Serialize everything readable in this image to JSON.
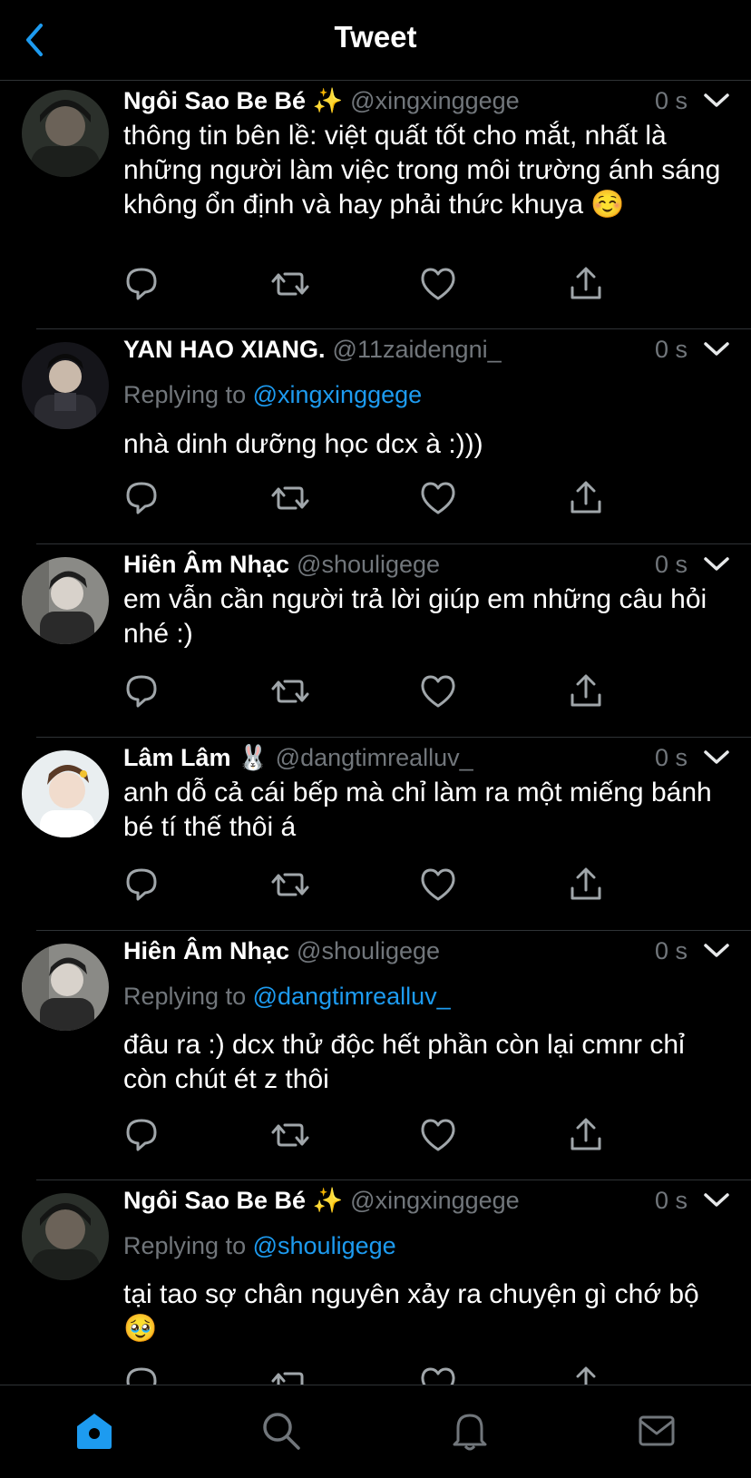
{
  "header": {
    "title": "Tweet",
    "back_icon": "chevron-left-icon",
    "accent": "#1d9bf0"
  },
  "tweets": [
    {
      "name": "Ngôi Sao Be Bé ✨",
      "handle": "@xingxinggege",
      "time": "0 s",
      "replying_prefix": "",
      "replying_to": "",
      "text": "thông tin bên lề: việt quất tốt cho mắt, nhất là những người làm việc trong môi trường ánh sáng không ổn định và hay phải thức khuya ☺️"
    },
    {
      "name": "YAN HAO XIANG.",
      "handle": "@11zaidengni_",
      "time": "0 s",
      "replying_prefix": "Replying to",
      "replying_to": "@xingxinggege",
      "text": "nhà dinh dưỡng học dcx à :)))"
    },
    {
      "name": "Hiên Âm Nhạc",
      "handle": "@shouligege",
      "time": "0 s",
      "replying_prefix": "",
      "replying_to": "",
      "text": "em vẫn cần người trả lời giúp em những câu hỏi nhé :)"
    },
    {
      "name": "Lâm Lâm 🐰",
      "handle": "@dangtimrealluv_",
      "time": "0 s",
      "replying_prefix": "",
      "replying_to": "",
      "text": "anh dỗ cả cái bếp mà chỉ làm ra một miếng bánh bé tí thế thôi á"
    },
    {
      "name": "Hiên Âm Nhạc",
      "handle": "@shouligege",
      "time": "0 s",
      "replying_prefix": "Replying to",
      "replying_to": "@dangtimrealluv_",
      "text": "đâu ra :) dcx thử độc hết phần còn lại cmnr chỉ còn chút ét z thôi"
    },
    {
      "name": "Ngôi Sao Be Bé ✨",
      "handle": "@xingxinggege",
      "time": "0 s",
      "replying_prefix": "Replying to",
      "replying_to": "@shouligege",
      "text": "tại tao sợ chân nguyên xảy ra chuyện gì chớ bộ 🥹"
    }
  ],
  "tab_bar": {
    "items": [
      "home-icon",
      "search-icon",
      "bell-icon",
      "mail-icon"
    ],
    "active": "home-icon"
  }
}
